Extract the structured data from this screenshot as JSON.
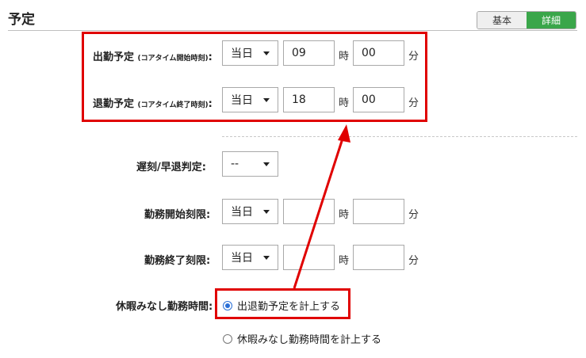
{
  "section": {
    "title": "予定"
  },
  "view_toggle": {
    "basic_label": "基本",
    "detail_label": "詳細"
  },
  "units": {
    "hour": "時",
    "minute": "分"
  },
  "core_time": {
    "start": {
      "label": "出勤予定",
      "sub_label": "(コアタイム開始時刻)",
      "colon": ":",
      "day": "当日",
      "hour": "09",
      "minute": "00"
    },
    "end": {
      "label": "退勤予定",
      "sub_label": "(コアタイム終了時刻)",
      "colon": ":",
      "day": "当日",
      "hour": "18",
      "minute": "00"
    }
  },
  "late_early": {
    "label": "遅刻/早退判定:",
    "value": "--"
  },
  "work_start_limit": {
    "label": "勤務開始刻限:",
    "day": "当日",
    "hour": "",
    "minute": ""
  },
  "work_end_limit": {
    "label": "勤務終了刻限:",
    "day": "当日",
    "hour": "",
    "minute": ""
  },
  "leave_hours": {
    "label": "休暇みなし勤務時間:",
    "options": [
      {
        "label": "出退勤予定を計上する",
        "checked": true
      },
      {
        "label": "休暇みなし勤務時間を計上する",
        "checked": false
      }
    ]
  },
  "colors": {
    "highlight": "#e00000",
    "accent": "#3aa64a",
    "radio": "#2a6fd6"
  }
}
